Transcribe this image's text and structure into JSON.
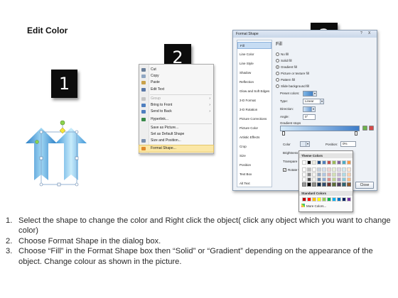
{
  "title": "Edit Color",
  "badges": [
    "1",
    "2",
    "3"
  ],
  "context_menu": {
    "items": [
      {
        "label": "Cut",
        "icon": "scissors-icon",
        "state": "normal"
      },
      {
        "label": "Copy",
        "icon": "copy-icon",
        "state": "normal"
      },
      {
        "label": "Paste",
        "icon": "paste-icon",
        "state": "normal"
      },
      {
        "label": "Edit Text",
        "icon": "edit-text-icon",
        "state": "normal"
      },
      {
        "label": "Group",
        "icon": "group-icon",
        "state": "disabled"
      },
      {
        "label": "Bring to Front",
        "icon": "bring-to-front-icon",
        "state": "normal"
      },
      {
        "label": "Send to Back",
        "icon": "send-to-back-icon",
        "state": "normal"
      },
      {
        "label": "Hyperlink...",
        "icon": "hyperlink-icon",
        "state": "normal"
      },
      {
        "label": "Save as Picture...",
        "icon": "",
        "state": "normal"
      },
      {
        "label": "Set as Default Shape",
        "icon": "",
        "state": "normal"
      },
      {
        "label": "Size and Position...",
        "icon": "size-position-icon",
        "state": "normal"
      },
      {
        "label": "Format Shape...",
        "icon": "format-shape-icon",
        "state": "active"
      }
    ]
  },
  "dialog": {
    "title": "Format Shape",
    "controls": [
      "?",
      "X"
    ],
    "nav": [
      "Fill",
      "Line Color",
      "Line Style",
      "Shadow",
      "Reflection",
      "Glow and Soft Edges",
      "3-D Format",
      "3-D Rotation",
      "Picture Corrections",
      "Picture Color",
      "Artistic Effects",
      "Crop",
      "Size",
      "Position",
      "Text Box",
      "Alt Text"
    ],
    "heading": "Fill",
    "fill_options": [
      {
        "label": "No fill",
        "checked": false
      },
      {
        "label": "Solid fill",
        "checked": false
      },
      {
        "label": "Gradient fill",
        "checked": true
      },
      {
        "label": "Picture or texture fill",
        "checked": false
      },
      {
        "label": "Pattern fill",
        "checked": false
      },
      {
        "label": "Slide background fill",
        "checked": false
      }
    ],
    "preset_label": "Preset colors:",
    "type_label": "Type:",
    "type_value": "Linear",
    "direction_label": "Direction:",
    "angle_label": "Angle:",
    "angle_value": "0°",
    "stops_label": "Gradient stops",
    "color_label": "Color",
    "position_label": "Position:",
    "position_value": "0%",
    "brightness_label": "Brightness",
    "transparency_label": "Transpare",
    "rotate_label": "Rotate w",
    "close_label": "Close"
  },
  "color_picker": {
    "theme_label": "Theme Colors",
    "standard_label": "Standard Colors",
    "more_label": "More Colors...",
    "theme_top": [
      "#ffffff",
      "#000000",
      "#eeece1",
      "#1f497d",
      "#4f81bd",
      "#c0504d",
      "#9bbb59",
      "#8064a2",
      "#4bacc6",
      "#f79646"
    ],
    "standard": [
      "#c00000",
      "#ff0000",
      "#ffc000",
      "#ffff00",
      "#92d050",
      "#00b050",
      "#00b0f0",
      "#0070c0",
      "#002060",
      "#7030a0"
    ]
  },
  "instructions": [
    {
      "num": "1.",
      "text": "Select the shape to change the color and Right click the object( click any object which you want to change color)"
    },
    {
      "num": "2.",
      "text": "Choose Format Shape in the dialog box."
    },
    {
      "num": "3.",
      "text": "Choose “Fill” in the Format Shape box then “Solid” or “Gradient” depending on the appearance of the object. Change colour as shown in the picture."
    }
  ]
}
